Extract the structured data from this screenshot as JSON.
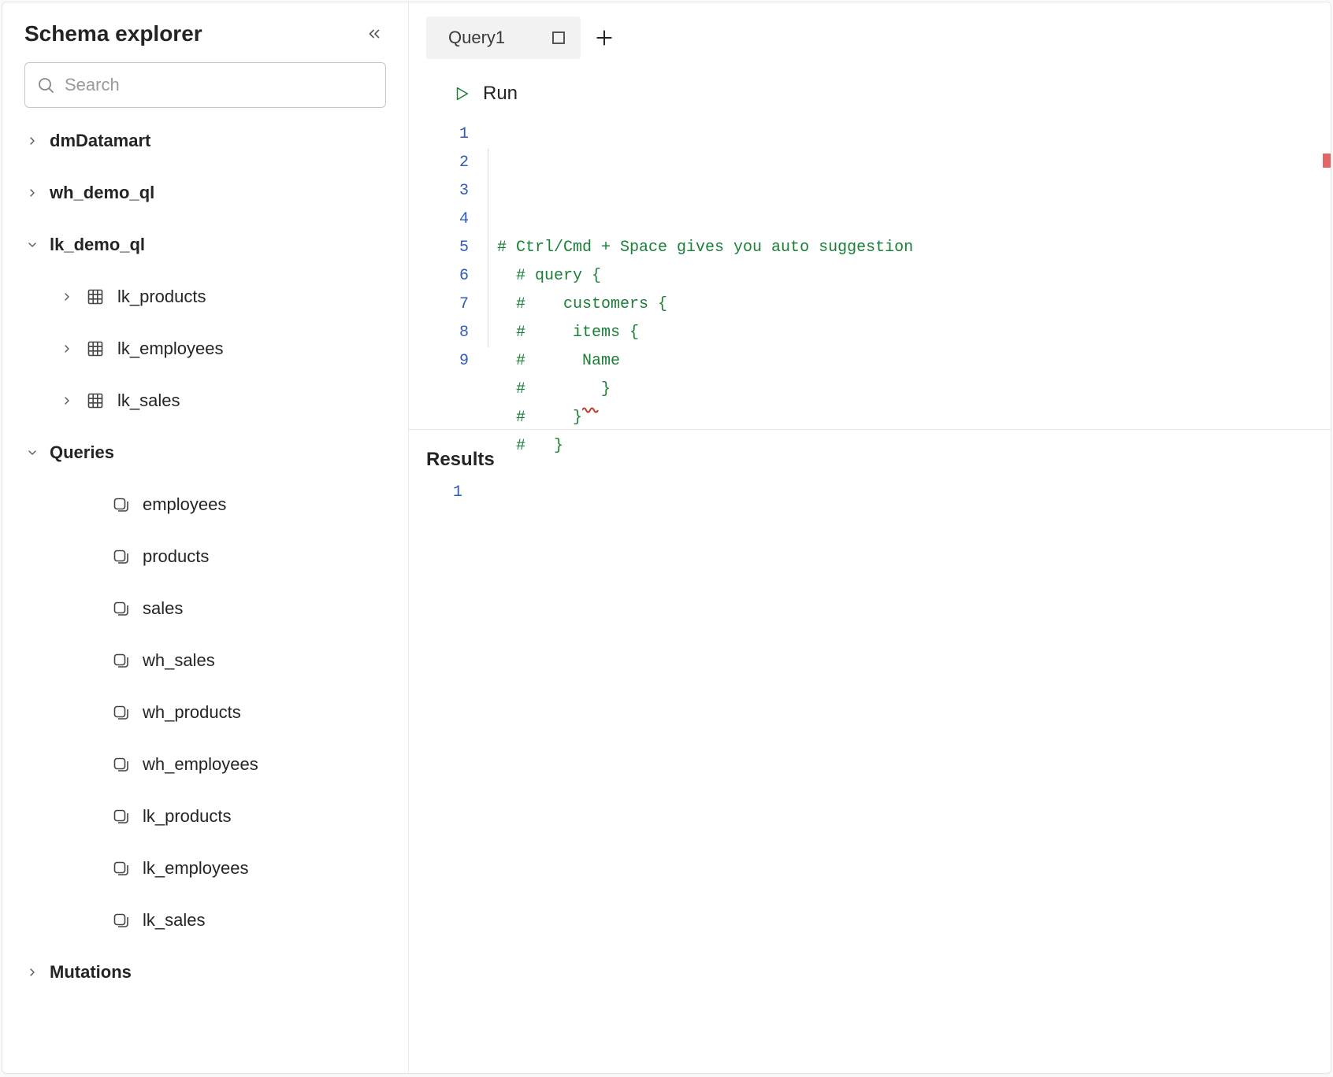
{
  "sidebar": {
    "title": "Schema explorer",
    "search": {
      "placeholder": "Search"
    },
    "tree": [
      {
        "id": "dmDatamart",
        "label": "dmDatamart",
        "depth": 0,
        "expanded": false,
        "bold": true,
        "icon": null
      },
      {
        "id": "wh_demo_ql",
        "label": "wh_demo_ql",
        "depth": 0,
        "expanded": false,
        "bold": true,
        "icon": null
      },
      {
        "id": "lk_demo_ql",
        "label": "lk_demo_ql",
        "depth": 0,
        "expanded": true,
        "bold": true,
        "icon": null
      },
      {
        "id": "lk_products",
        "label": "lk_products",
        "depth": 1,
        "expanded": false,
        "bold": false,
        "icon": "table"
      },
      {
        "id": "lk_employees",
        "label": "lk_employees",
        "depth": 1,
        "expanded": false,
        "bold": false,
        "icon": "table"
      },
      {
        "id": "lk_sales",
        "label": "lk_sales",
        "depth": 1,
        "expanded": false,
        "bold": false,
        "icon": "table"
      },
      {
        "id": "Queries",
        "label": "Queries",
        "depth": 0,
        "expanded": true,
        "bold": true,
        "icon": null
      },
      {
        "id": "q_employees",
        "label": "employees",
        "depth": 2,
        "expanded": null,
        "bold": false,
        "icon": "query"
      },
      {
        "id": "q_products",
        "label": "products",
        "depth": 2,
        "expanded": null,
        "bold": false,
        "icon": "query"
      },
      {
        "id": "q_sales",
        "label": "sales",
        "depth": 2,
        "expanded": null,
        "bold": false,
        "icon": "query"
      },
      {
        "id": "q_wh_sales",
        "label": "wh_sales",
        "depth": 2,
        "expanded": null,
        "bold": false,
        "icon": "query"
      },
      {
        "id": "q_wh_products",
        "label": "wh_products",
        "depth": 2,
        "expanded": null,
        "bold": false,
        "icon": "query"
      },
      {
        "id": "q_wh_employees",
        "label": "wh_employees",
        "depth": 2,
        "expanded": null,
        "bold": false,
        "icon": "query"
      },
      {
        "id": "q_lk_products",
        "label": "lk_products",
        "depth": 2,
        "expanded": null,
        "bold": false,
        "icon": "query"
      },
      {
        "id": "q_lk_employees",
        "label": "lk_employees",
        "depth": 2,
        "expanded": null,
        "bold": false,
        "icon": "query"
      },
      {
        "id": "q_lk_sales",
        "label": "lk_sales",
        "depth": 2,
        "expanded": null,
        "bold": false,
        "icon": "query"
      },
      {
        "id": "Mutations",
        "label": "Mutations",
        "depth": 0,
        "expanded": false,
        "bold": true,
        "icon": null
      }
    ]
  },
  "tabs": {
    "items": [
      {
        "label": "Query1",
        "unsaved": true
      }
    ]
  },
  "toolbar": {
    "run_label": "Run"
  },
  "editor": {
    "lines": [
      "# Ctrl/Cmd + Space gives you auto suggestion",
      "  # query {",
      "  #    customers {",
      "  #     items {",
      "  #      Name",
      "  #        }",
      "  #     }",
      "  #   }",
      ""
    ]
  },
  "results": {
    "title": "Results",
    "lines": [
      ""
    ]
  }
}
